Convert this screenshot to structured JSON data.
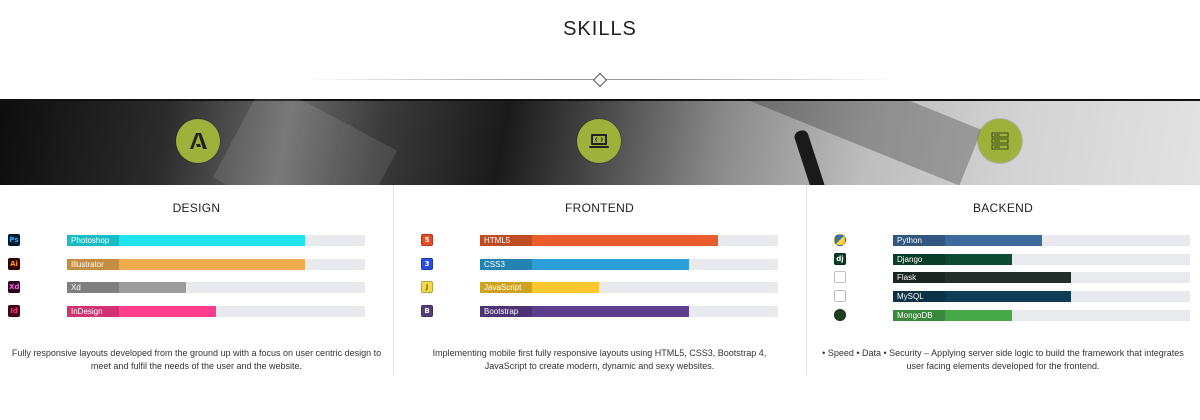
{
  "title": "SKILLS",
  "banner": {
    "icons": [
      "adobe-icon",
      "code-laptop-icon",
      "server-icon"
    ],
    "circle_color": "#9eb23b"
  },
  "columns": [
    {
      "heading": "DESIGN",
      "description_line1": "Fully responsive layouts developed from the ground up with a focus on user centric design to",
      "description_line2": "meet and fulfil the needs of the user and the website.",
      "skills": [
        {
          "label": "Photoshop",
          "icon": "photoshop-icon",
          "icon_text": "Ps",
          "icon_color": "#001e36",
          "icon_fg": "#31a8ff",
          "color": "#1fe4f0",
          "level": 0.8
        },
        {
          "label": "Illustrator",
          "icon": "illustrator-icon",
          "icon_text": "Ai",
          "icon_color": "#330000",
          "icon_fg": "#ff9a00",
          "color": "#f0ad4e",
          "level": 0.8
        },
        {
          "label": "Xd",
          "icon": "xd-icon",
          "icon_text": "Xd",
          "icon_color": "#2e001e",
          "icon_fg": "#ff61f6",
          "color": "#9c9c9c",
          "level": 0.4
        },
        {
          "label": "InDesign",
          "icon": "indesign-icon",
          "icon_text": "Id",
          "icon_color": "#49021f",
          "icon_fg": "#ff3366",
          "color": "#ff3d8b",
          "level": 0.5
        }
      ]
    },
    {
      "heading": "FRONTEND",
      "description_line1": "Implementing mobile first fully responsive layouts using HTML5, CSS3, Bootstrap 4,",
      "description_line2": "JavaScript to create modern, dynamic and sexy websites.",
      "skills": [
        {
          "label": "HTML5",
          "icon": "html5-icon",
          "icon_text": "5",
          "icon_color": "#e44d26",
          "icon_fg": "#ffffff",
          "color": "#e95e2c",
          "level": 0.8
        },
        {
          "label": "CSS3",
          "icon": "css3-icon",
          "icon_text": "3",
          "icon_color": "#264de4",
          "icon_fg": "#ffffff",
          "color": "#2d9fd8",
          "level": 0.7
        },
        {
          "label": "JavaScript",
          "icon": "javascript-icon",
          "icon_text": "J",
          "icon_color": "#f0db4f",
          "icon_fg": "#8a6d00",
          "color": "#fcc72c",
          "level": 0.4
        },
        {
          "label": "Bootstrap",
          "icon": "bootstrap-icon",
          "icon_text": "B",
          "icon_color": "#563d7c",
          "icon_fg": "#ffffff",
          "color": "#5d3f8e",
          "level": 0.7
        }
      ]
    },
    {
      "heading": "BACKEND",
      "description_line1": "• Speed • Data • Security – Applying server side logic to build the framework that integrates",
      "description_line2": "user facing elements developed for the frontend.",
      "skills": [
        {
          "label": "Python",
          "icon": "python-icon",
          "icon_text": "",
          "icon_color": "#3776ab",
          "icon_fg": "#ffd43b",
          "color": "#3c6a9b",
          "level": 0.5
        },
        {
          "label": "Django",
          "icon": "django-icon",
          "icon_text": "dj",
          "icon_color": "#0c3c26",
          "icon_fg": "#ffffff",
          "color": "#0c4b33",
          "level": 0.4
        },
        {
          "label": "Flask",
          "icon": "flask-icon",
          "icon_text": "",
          "icon_color": "#ffffff",
          "icon_fg": "#000000",
          "color": "#222e2a",
          "level": 0.6
        },
        {
          "label": "MySQL",
          "icon": "mysql-icon",
          "icon_text": "",
          "icon_color": "#ffffff",
          "icon_fg": "#4479a1",
          "color": "#0f3d57",
          "level": 0.6
        },
        {
          "label": "MongoDB",
          "icon": "mongodb-icon",
          "icon_text": "",
          "icon_color": "#1f3d1f",
          "icon_fg": "#4db33d",
          "color": "#46a847",
          "level": 0.4
        }
      ]
    }
  ]
}
